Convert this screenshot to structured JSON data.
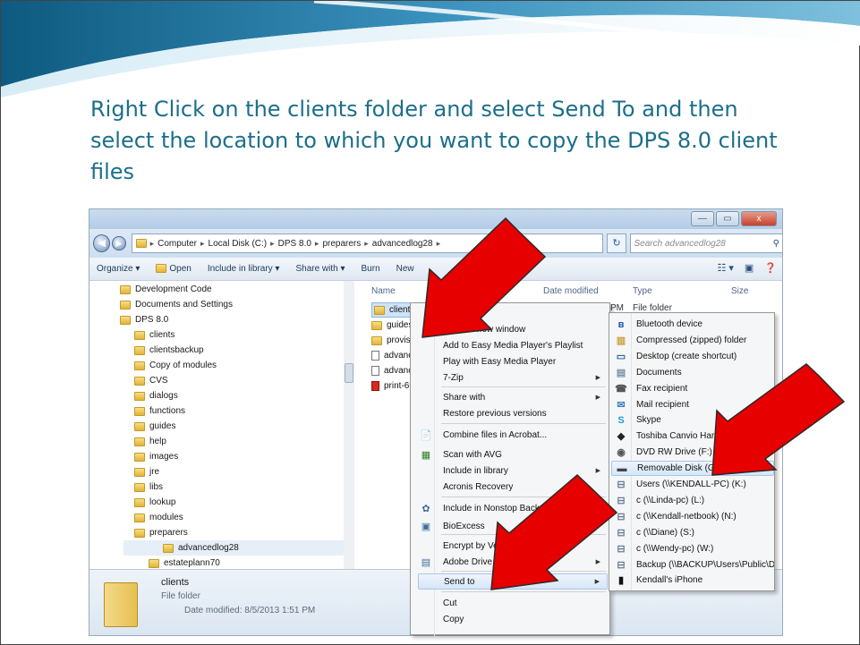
{
  "instruction": "Right Click on the clients folder and select Send To and then select the location to which you want to copy the DPS 8.0 client files",
  "window_buttons": [
    "—",
    "▭",
    "x"
  ],
  "address": {
    "crumbs": [
      "Computer",
      "Local Disk (C:)",
      "DPS 8.0",
      "preparers",
      "advancedlog28"
    ],
    "search_placeholder": "Search advancedlog28"
  },
  "toolbar": {
    "organize": "Organize ▾",
    "open": "Open",
    "include": "Include in library ▾",
    "share": "Share with ▾",
    "burn": "Burn",
    "new": "New"
  },
  "tree": [
    {
      "label": "Development Code",
      "indent": 0
    },
    {
      "label": "Documents and Settings",
      "indent": 0
    },
    {
      "label": "DPS 8.0",
      "indent": 0
    },
    {
      "label": "clients",
      "indent": 1
    },
    {
      "label": "clientsbackup",
      "indent": 1
    },
    {
      "label": "Copy of modules",
      "indent": 1
    },
    {
      "label": "CVS",
      "indent": 1
    },
    {
      "label": "dialogs",
      "indent": 1
    },
    {
      "label": "functions",
      "indent": 1
    },
    {
      "label": "guides",
      "indent": 1
    },
    {
      "label": "help",
      "indent": 1
    },
    {
      "label": "images",
      "indent": 1
    },
    {
      "label": "jre",
      "indent": 1
    },
    {
      "label": "libs",
      "indent": 1
    },
    {
      "label": "lookup",
      "indent": 1
    },
    {
      "label": "modules",
      "indent": 1
    },
    {
      "label": "preparers",
      "indent": 1
    },
    {
      "label": "advancedlog28",
      "indent": 2
    },
    {
      "label": "estateplann70",
      "indent": 2
    }
  ],
  "columns": {
    "name": "Name",
    "date": "Date modified",
    "type": "Type",
    "size": "Size"
  },
  "files": [
    {
      "label": "clients",
      "kind": "folder"
    },
    {
      "label": "guides",
      "kind": "folder"
    },
    {
      "label": "provisio",
      "kind": "folder"
    },
    {
      "label": "advance",
      "kind": "doc"
    },
    {
      "label": "advance",
      "kind": "doc"
    },
    {
      "label": "print-69",
      "kind": "pdf"
    }
  ],
  "row_peek": {
    "pm": "PM",
    "type": "File folder"
  },
  "details": {
    "name": "clients",
    "type": "File folder",
    "date": "Date modified: 8/5/2013 1:51 PM"
  },
  "context_menu": [
    {
      "label": "Open",
      "bold": true
    },
    {
      "label": "Open in new window"
    },
    {
      "label": "Add to Easy Media Player's Playlist"
    },
    {
      "label": "Play with Easy Media Player"
    },
    {
      "label": "7-Zip",
      "arrow": true
    },
    {
      "label": "Share with",
      "arrow": true
    },
    {
      "label": "Restore previous versions"
    },
    {
      "label": "Combine files in Acrobat...",
      "icon": "acrobat-icon"
    },
    {
      "label": "Scan with AVG",
      "icon": "avg-icon"
    },
    {
      "label": "Include in library",
      "arrow": true
    },
    {
      "label": "Acronis Recovery"
    },
    {
      "label": "Include in Nonstop Backup",
      "icon": "nonstop-backup-icon"
    },
    {
      "label": "BioExcess",
      "icon": "bioexcess-icon"
    },
    {
      "label": "Encrypt by Verif"
    },
    {
      "label": "Adobe Drive",
      "icon": "adobe-drive-icon",
      "arrow": true
    },
    {
      "label": "Send to",
      "arrow": true
    },
    {
      "label": "Cut"
    },
    {
      "label": "Copy"
    }
  ],
  "send_to_menu": [
    {
      "label": "Bluetooth device",
      "icon": "bluetooth-icon"
    },
    {
      "label": "Compressed (zipped) folder",
      "icon": "zip-folder-icon"
    },
    {
      "label": "Desktop (create shortcut)",
      "icon": "desktop-icon"
    },
    {
      "label": "Documents",
      "icon": "documents-icon"
    },
    {
      "label": "Fax recipient",
      "icon": "fax-icon"
    },
    {
      "label": "Mail recipient",
      "icon": "mail-icon"
    },
    {
      "label": "Skype",
      "icon": "skype-icon"
    },
    {
      "label": "Toshiba Canvio Hard D",
      "icon": "hard-drive-icon"
    },
    {
      "label": "DVD RW Drive (F:)",
      "icon": "dvd-drive-icon"
    },
    {
      "label": "Removable Disk (G:)",
      "icon": "removable-disk-icon"
    },
    {
      "label": "Users (\\\\KENDALL-PC) (K:)",
      "icon": "network-drive-icon"
    },
    {
      "label": "c (\\\\Linda-pc) (L:)",
      "icon": "network-drive-icon"
    },
    {
      "label": "c (\\\\Kendall-netbook) (N:)",
      "icon": "network-drive-icon"
    },
    {
      "label": "c (\\\\Diane) (S:)",
      "icon": "network-drive-icon"
    },
    {
      "label": "c (\\\\Wendy-pc) (W:)",
      "icon": "network-drive-icon"
    },
    {
      "label": "Backup (\\\\BACKUP\\Users\\Public\\Doc",
      "icon": "network-drive-icon"
    },
    {
      "label": "Kendall's iPhone",
      "icon": "iphone-icon"
    }
  ],
  "colors": {
    "instruction": "#1b6f8a",
    "arrow": "#e60000",
    "swoosh": "#2a7ea6"
  }
}
